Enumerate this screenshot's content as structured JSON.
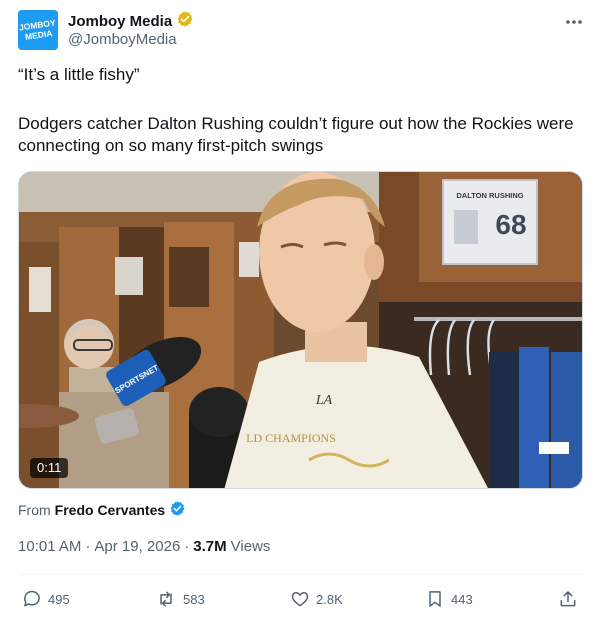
{
  "author": {
    "name": "Jomboy Media",
    "handle": "@JomboyMedia",
    "avatar_text_line1": "JOMBOY",
    "avatar_text_line2": "MEDIA",
    "verified_badge": "gold-check-icon"
  },
  "tweet": {
    "quote": "“It’s a little fishy”",
    "body": "Dodgers catcher Dalton Rushing couldn’t figure out how the Rockies were connecting on so many first-pitch swings"
  },
  "media": {
    "duration": "0:11",
    "nameplate_name": "DALTON RUSHING",
    "nameplate_number": "68",
    "mic_label": "SPORTSNET",
    "shirt_text_line1": "LA",
    "shirt_text_line2": "LD CHAMPIONS"
  },
  "from": {
    "prefix": "From",
    "name": "Fredo Cervantes"
  },
  "meta": {
    "time": "10:01 AM",
    "separator1": "·",
    "date": "Apr 19, 2026",
    "separator2": "·",
    "views_count": "3.7M",
    "views_label": "Views"
  },
  "actions": {
    "replies": "495",
    "reposts": "583",
    "likes": "2.8K",
    "bookmarks": "443"
  },
  "colors": {
    "accent": "#1d9bf0",
    "verified_gold": "#e2b719",
    "text_secondary": "#536471",
    "text_primary": "#0f1419"
  }
}
